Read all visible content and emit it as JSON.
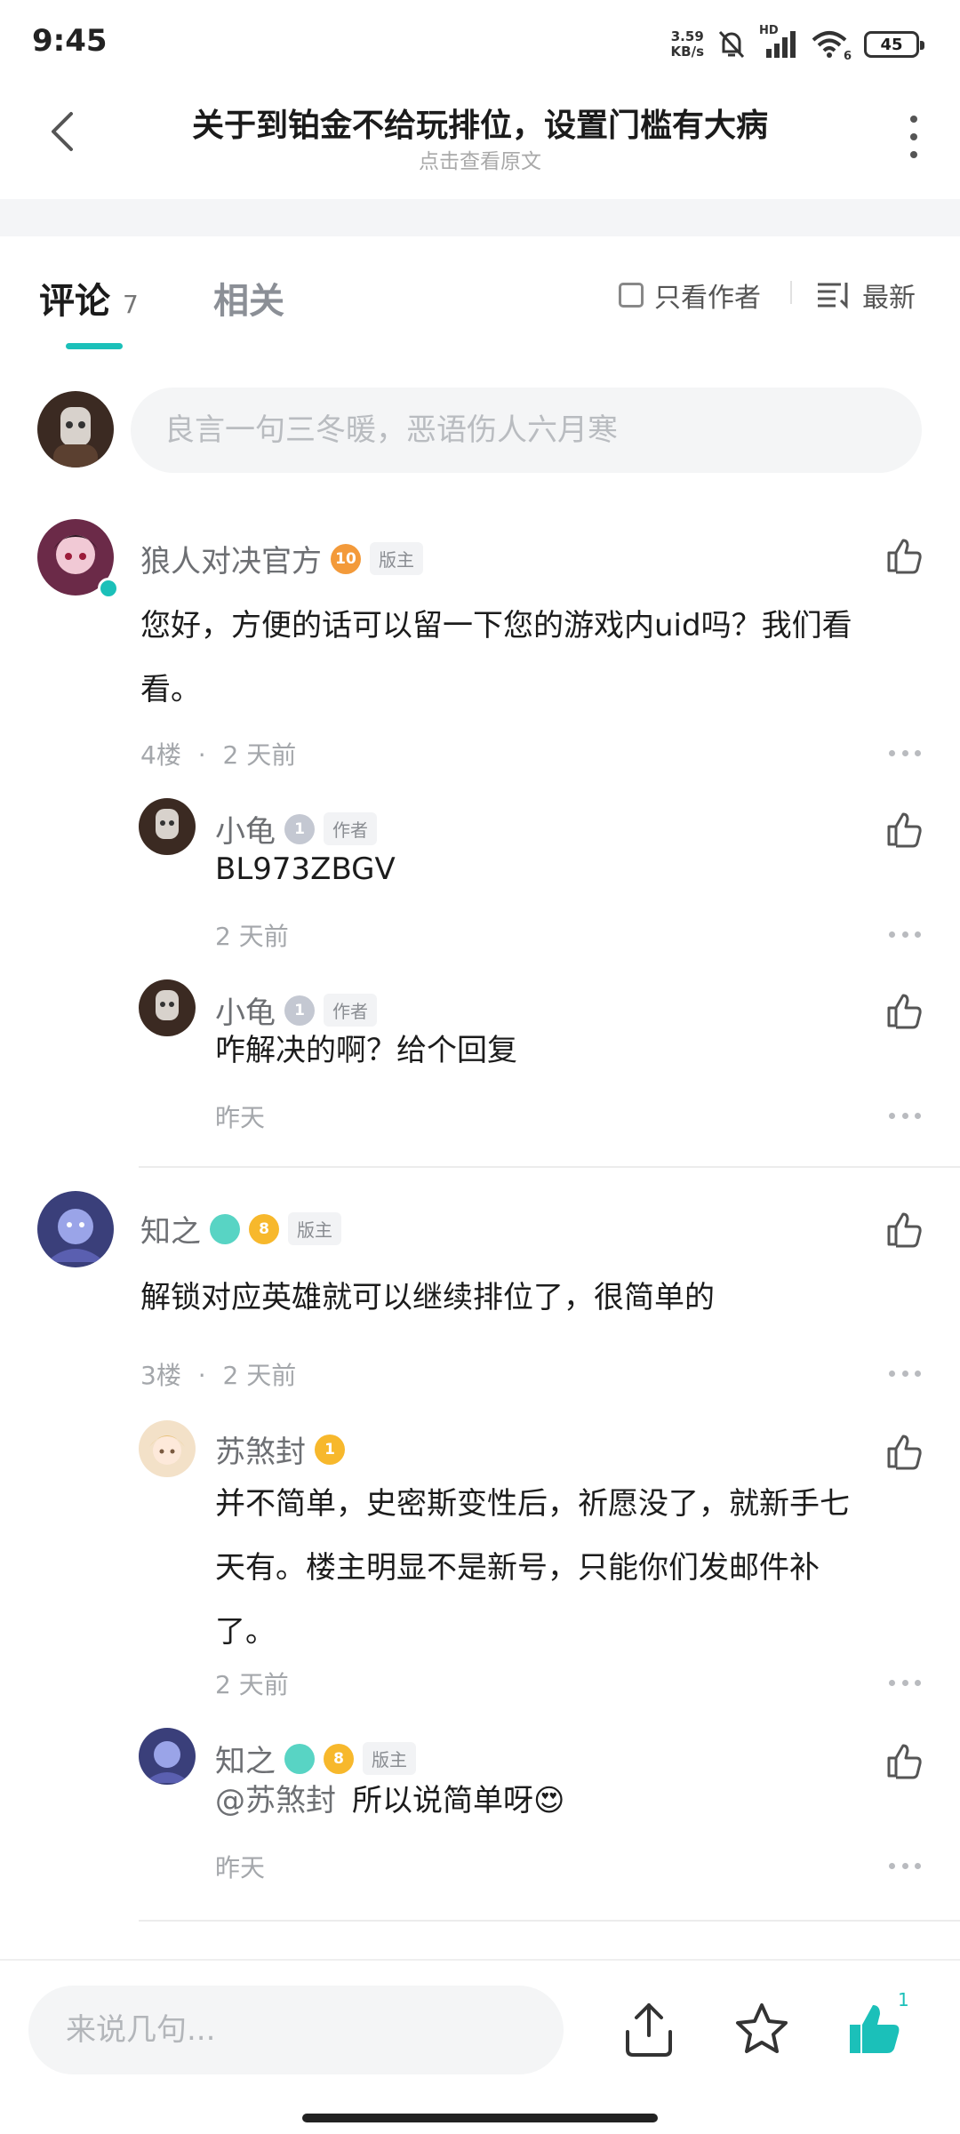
{
  "status": {
    "time": "9:45",
    "net_speed_value": "3.59",
    "net_speed_unit": "KB/s",
    "hd": "HD",
    "wifi_num": "6",
    "battery": "45"
  },
  "header": {
    "title": "关于到铂金不给玩排位，设置门槛有大病",
    "subtitle": "点击查看原文"
  },
  "tabs": {
    "comments_label": "评论",
    "comments_count": "7",
    "related_label": "相关",
    "only_author": "只看作者",
    "sort": "最新"
  },
  "input": {
    "placeholder": "良言一句三冬暖，恶语伤人六月寒"
  },
  "comments": [
    {
      "name": "狼人对决官方",
      "level": "10",
      "tag": "版主",
      "text_line1": "您好，方便的话可以留一下您的游戏内uid吗？我们看",
      "text_line2": "看。",
      "floor": "4楼",
      "sep": "·",
      "time": "2 天前",
      "replies": [
        {
          "name": "小龟",
          "level": "1",
          "tag": "作者",
          "text": "BL973ZBGV",
          "time": "2 天前"
        },
        {
          "name": "小龟",
          "level": "1",
          "tag": "作者",
          "text": "咋解决的啊？给个回复",
          "time": "昨天"
        }
      ]
    },
    {
      "name": "知之",
      "level": "8",
      "tag": "版主",
      "text_line1": "解锁对应英雄就可以继续排位了，很简单的",
      "floor": "3楼",
      "sep": "·",
      "time": "2 天前",
      "replies": [
        {
          "name": "苏煞封",
          "level": "1",
          "text_line1": "并不简单，史密斯变性后，祈愿没了，就新手七",
          "text_line2": "天有。楼主明显不是新号，只能你们发邮件补",
          "text_line3": "了。",
          "time": "2 天前"
        },
        {
          "name": "知之",
          "level": "8",
          "tag": "版主",
          "mention": "@苏煞封",
          "text": "所以说简单呀",
          "emoji": "😍",
          "time": "昨天"
        }
      ]
    }
  ],
  "bottom": {
    "reply_placeholder": "来说几句...",
    "like_count": "1"
  },
  "colors": {
    "accent": "#1bc0b9",
    "gold": "#f7b82c",
    "name_gray": "#6d6f73"
  }
}
